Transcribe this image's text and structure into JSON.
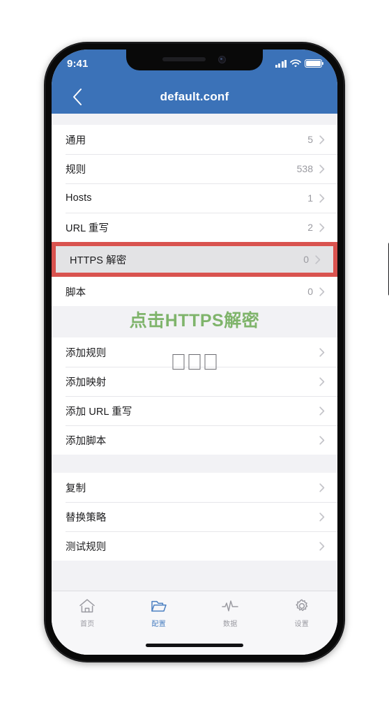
{
  "statusbar": {
    "time": "9:41",
    "signal_icon": "cellular-signal-icon",
    "wifi_icon": "wifi-icon",
    "battery_icon": "battery-icon"
  },
  "navbar": {
    "back_icon": "chevron-left-icon",
    "title": "default.conf",
    "background_color": "#3b72b8"
  },
  "annotation": {
    "text": "点击HTTPS解密",
    "color": "#7fb46b",
    "tofu_glyphs": [
      "□",
      "□",
      "□"
    ]
  },
  "highlight": {
    "border_color": "#d9534f",
    "target_row_label": "HTTPS 解密"
  },
  "sections": [
    {
      "name": "config-summary",
      "rows": [
        {
          "label": "通用",
          "value": "5",
          "chevron": "chevron-right-icon",
          "highlighted": false
        },
        {
          "label": "规则",
          "value": "538",
          "chevron": "chevron-right-icon",
          "highlighted": false
        },
        {
          "label": "Hosts",
          "value": "1",
          "chevron": "chevron-right-icon",
          "highlighted": false
        },
        {
          "label": "URL 重写",
          "value": "2",
          "chevron": "chevron-right-icon",
          "highlighted": false
        },
        {
          "label": "HTTPS 解密",
          "value": "0",
          "chevron": "chevron-right-icon",
          "highlighted": true
        },
        {
          "label": "脚本",
          "value": "0",
          "chevron": "chevron-right-icon",
          "highlighted": false
        }
      ]
    },
    {
      "name": "add-actions",
      "rows": [
        {
          "label": "添加规则",
          "value": "",
          "chevron": "chevron-right-icon",
          "highlighted": false
        },
        {
          "label": "添加映射",
          "value": "",
          "chevron": "chevron-right-icon",
          "highlighted": false
        },
        {
          "label": "添加 URL 重写",
          "value": "",
          "chevron": "chevron-right-icon",
          "highlighted": false
        },
        {
          "label": "添加脚本",
          "value": "",
          "chevron": "chevron-right-icon",
          "highlighted": false
        }
      ]
    },
    {
      "name": "file-actions",
      "rows": [
        {
          "label": "复制",
          "value": "",
          "chevron": "chevron-right-icon",
          "highlighted": false
        },
        {
          "label": "替换策略",
          "value": "",
          "chevron": "chevron-right-icon",
          "highlighted": false
        },
        {
          "label": "测试规则",
          "value": "",
          "chevron": "chevron-right-icon",
          "highlighted": false
        }
      ]
    }
  ],
  "tabbar": {
    "active_color": "#4a7fc1",
    "inactive_color": "#9b9ba2",
    "tabs": [
      {
        "label": "首页",
        "icon": "home-icon",
        "active": false
      },
      {
        "label": "配置",
        "icon": "folder-icon",
        "active": true
      },
      {
        "label": "数据",
        "icon": "pulse-icon",
        "active": false
      },
      {
        "label": "设置",
        "icon": "gear-icon",
        "active": false
      }
    ]
  }
}
